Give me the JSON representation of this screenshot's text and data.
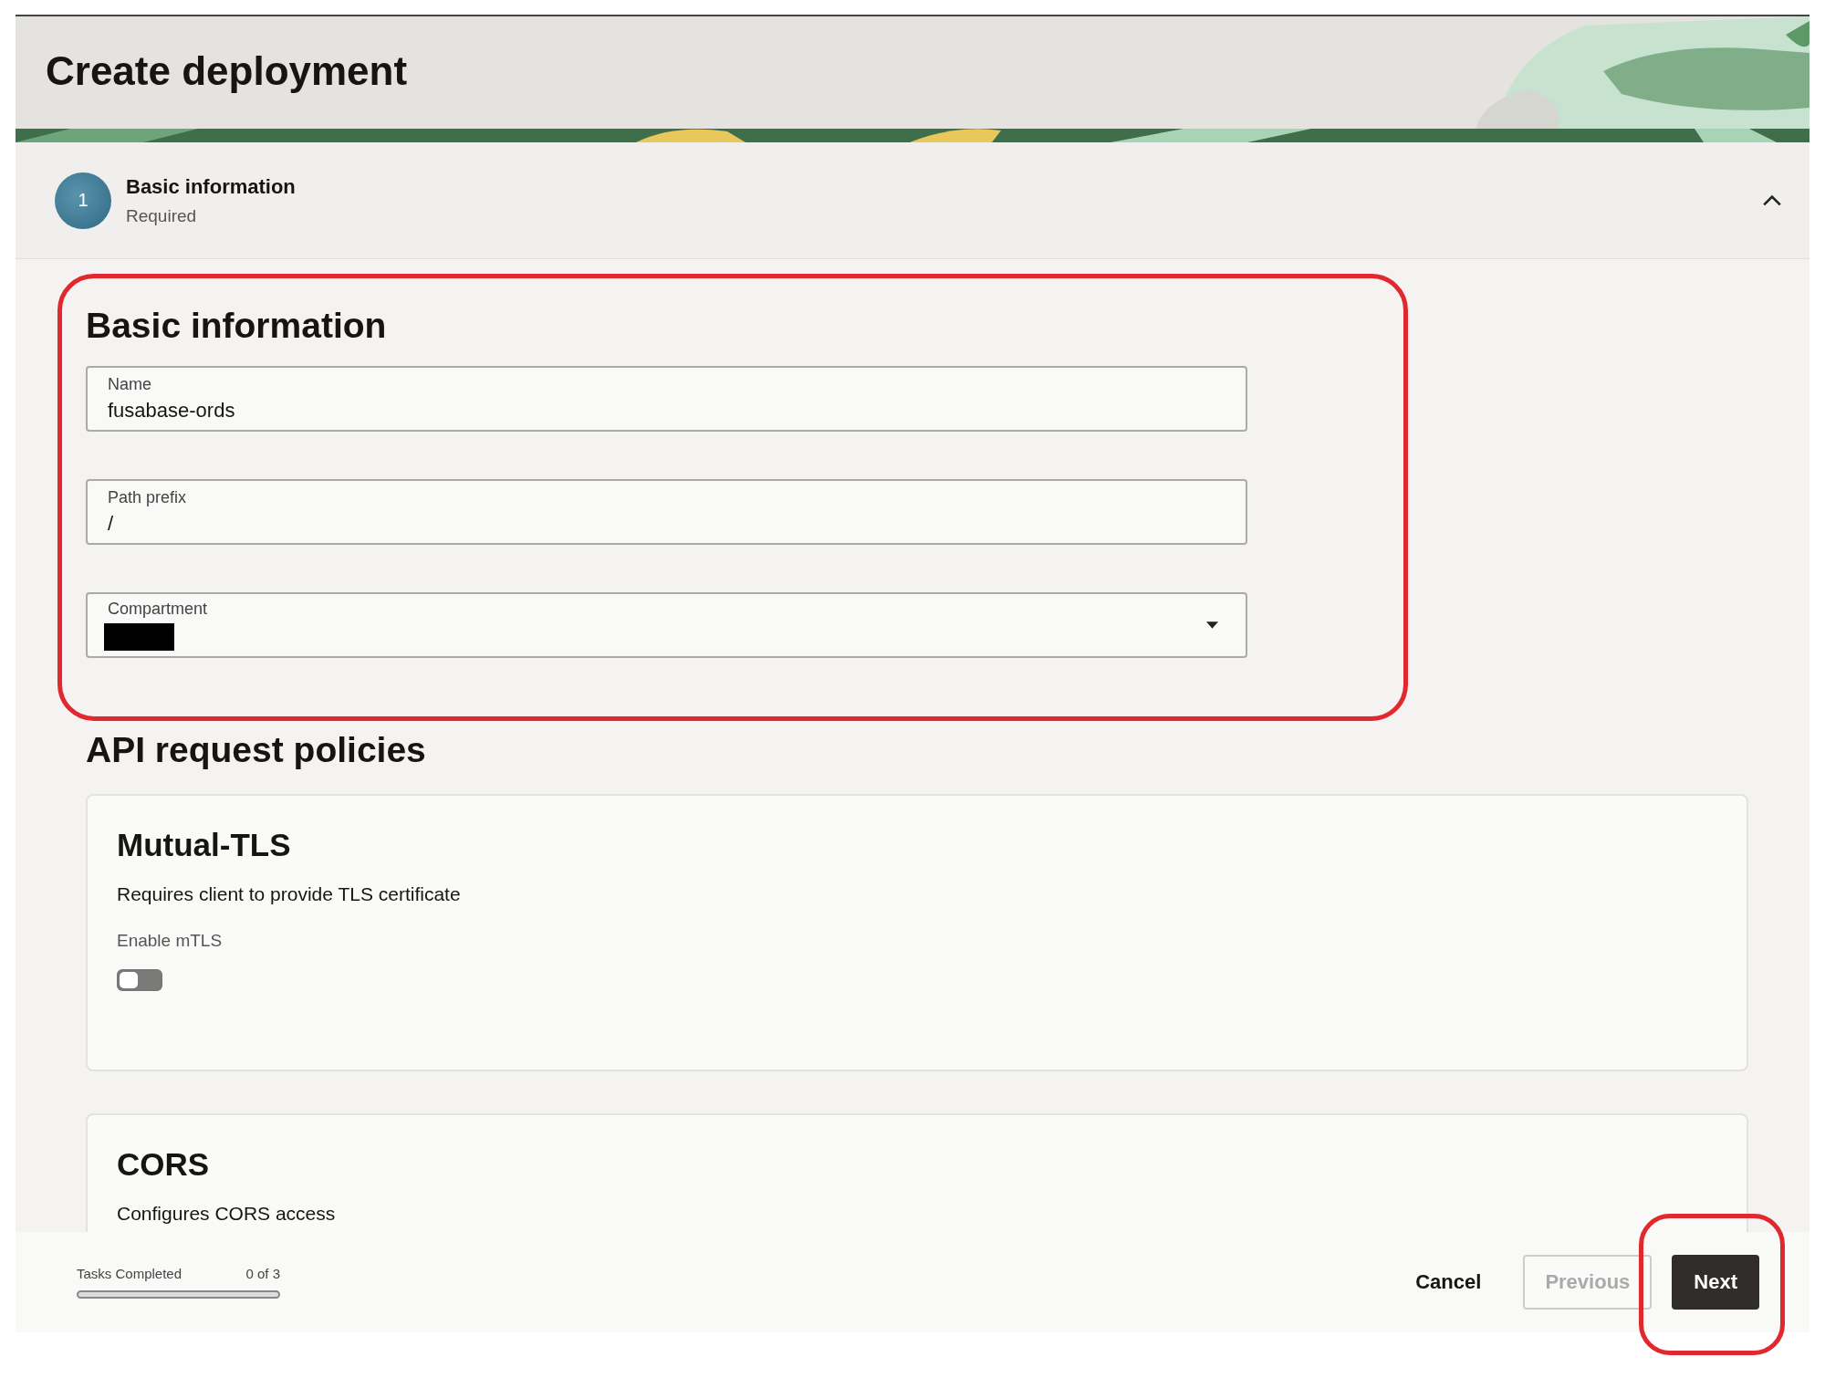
{
  "page": {
    "title": "Create deployment"
  },
  "step": {
    "number": "1",
    "title": "Basic information",
    "subtitle": "Required",
    "expanded": true
  },
  "basic_information": {
    "heading": "Basic information",
    "highlighted": true,
    "fields": [
      {
        "kind": "text",
        "label": "Name",
        "value": "fusabase-ords"
      },
      {
        "kind": "text",
        "label": "Path prefix",
        "value": "/"
      },
      {
        "kind": "select",
        "label": "Compartment",
        "value_redacted": true
      }
    ]
  },
  "policies": {
    "heading": "API request policies",
    "cards": [
      {
        "kind": "toggle",
        "title": "Mutual-TLS",
        "description": "Requires client to provide TLS certificate",
        "toggle_label": "Enable mTLS",
        "on": false
      },
      {
        "kind": "plain",
        "title": "CORS",
        "description": "Configures CORS access"
      }
    ]
  },
  "footer": {
    "progress_label": "Tasks Completed",
    "progress_count": "0 of 3",
    "level": 0,
    "buttons": [
      {
        "kind": "text",
        "label": "Cancel",
        "disabled": false,
        "highlighted": false
      },
      {
        "kind": "outline",
        "label": "Previous",
        "disabled": true,
        "highlighted": false
      },
      {
        "kind": "primary",
        "label": "Next",
        "disabled": false,
        "highlighted": true
      }
    ]
  }
}
